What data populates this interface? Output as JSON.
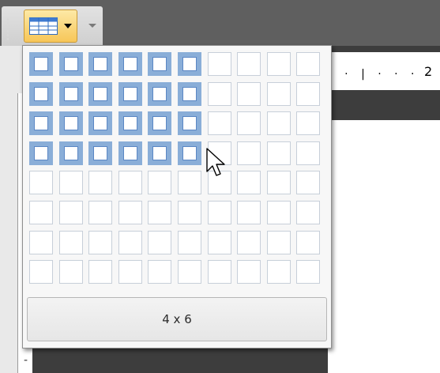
{
  "toolbar": {
    "insert_table_button": {
      "icon": "table-icon",
      "has_dropdown": true
    },
    "overflow_icon": "chevron-down-icon"
  },
  "ruler": {
    "visible_number": "2"
  },
  "table_picker": {
    "rows": 8,
    "columns": 10,
    "selected_rows": 4,
    "selected_columns": 6,
    "size_label": "4 x 6",
    "selected_color": "#8aaed8",
    "cell_border_color": "#c7cfd9"
  },
  "vertical_ruler": {
    "mark": "-"
  }
}
